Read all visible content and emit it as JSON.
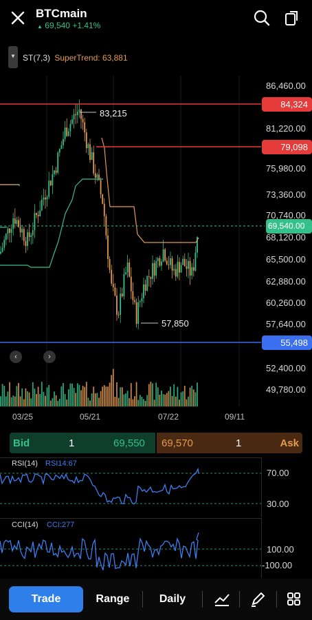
{
  "header": {
    "title": "BTCmain",
    "price": "69,540",
    "change": "+1.41%",
    "close_icon": "close-icon",
    "search_icon": "search-icon",
    "share_icon": "share-icon"
  },
  "indicator": {
    "name": "ST(7,3)",
    "value_text": "SuperTrend: 63,881"
  },
  "price_axis": [
    "86,460.00",
    "81,220.00",
    "75,980.00",
    "73,360.00",
    "70,740.00",
    "68,120.00",
    "65,500.00",
    "62,880.00",
    "60,260.00",
    "57,640.00",
    "52,400.00",
    "49,780.00"
  ],
  "levels": {
    "red1": "84,324",
    "red2": "79,098",
    "current": "69,540.00",
    "blue": "55,498"
  },
  "annotations": {
    "high": "83,215",
    "low": "57,850"
  },
  "x_labels": [
    "03/25",
    "05/21",
    "07/22",
    "09/11"
  ],
  "orderbook": {
    "bid_label": "Bid",
    "bid_qty": "1",
    "bid_price": "69,550",
    "ask_price": "69,570",
    "ask_qty": "1",
    "ask_label": "Ask"
  },
  "rsi": {
    "title": "RSI(14)",
    "value": "RSI14:67",
    "levels": [
      "70.00",
      "30.00"
    ]
  },
  "cci": {
    "title": "CCI(14)",
    "value": "CCI:277",
    "levels": [
      "100.00",
      "-100.00"
    ]
  },
  "bottom_bar": {
    "trade": "Trade",
    "range": "Range",
    "daily": "Daily",
    "icons": [
      "chart-type-icon",
      "draw-icon",
      "grid-icon"
    ]
  },
  "colors": {
    "up": "#35c08b",
    "down": "#e39a4f",
    "red_line": "#e63b3b",
    "blue_line": "#3a6ff0",
    "supertrend_up": "#35c08b",
    "supertrend_down": "#e39a4f",
    "indicator_line": "#3d7ef0"
  }
}
